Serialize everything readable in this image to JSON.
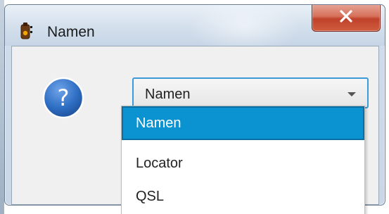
{
  "window": {
    "title": "Namen",
    "icon": "app-bottle-icon",
    "close_icon": "close-icon"
  },
  "dialog": {
    "icon": "question-icon",
    "icon_color": "#2f6fc4",
    "combo": {
      "value": "Namen",
      "arrow_icon": "chevron-down-icon",
      "accent": "#3c9ad6"
    },
    "dropdown": {
      "selected_color": "#0b93d1",
      "options": [
        {
          "label": "Namen",
          "selected": true
        },
        {
          "label": "Locator",
          "selected": false
        },
        {
          "label": "QSL",
          "selected": false
        }
      ]
    }
  }
}
